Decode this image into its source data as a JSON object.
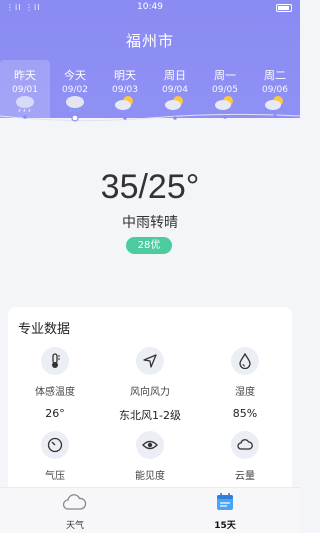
{
  "status_bar": {
    "time": "10:49",
    "signal": "⋮il ⋮il"
  },
  "header": {
    "city": "福州市"
  },
  "days": [
    {
      "name": "昨天",
      "date": "09/01"
    },
    {
      "name": "今天",
      "date": "09/02"
    },
    {
      "name": "明天",
      "date": "09/03"
    },
    {
      "name": "周日",
      "date": "09/04"
    },
    {
      "name": "周一",
      "date": "09/05"
    },
    {
      "name": "周二",
      "date": "09/06"
    }
  ],
  "current": {
    "temp": "35/25°",
    "desc": "中雨转晴",
    "aqi": "28优"
  },
  "panel": {
    "title": "专业数据",
    "items": [
      {
        "label": "体感温度",
        "value": "26°",
        "icon": "thermometer-icon"
      },
      {
        "label": "风向风力",
        "value": "东北风1-2级",
        "icon": "navigation-arrow-icon"
      },
      {
        "label": "湿度",
        "value": "85%",
        "icon": "water-drop-icon"
      },
      {
        "label": "气压",
        "value": "",
        "icon": "gauge-icon"
      },
      {
        "label": "能见度",
        "value": "",
        "icon": "eye-icon"
      },
      {
        "label": "云量",
        "value": "",
        "icon": "cloud-icon"
      }
    ]
  },
  "nav": {
    "weather": "天气",
    "fifteen_days": "15天"
  },
  "colors": {
    "header": "#8b8cf3",
    "aqi_good": "#4ccc9e",
    "background": "#f4f5f9"
  }
}
